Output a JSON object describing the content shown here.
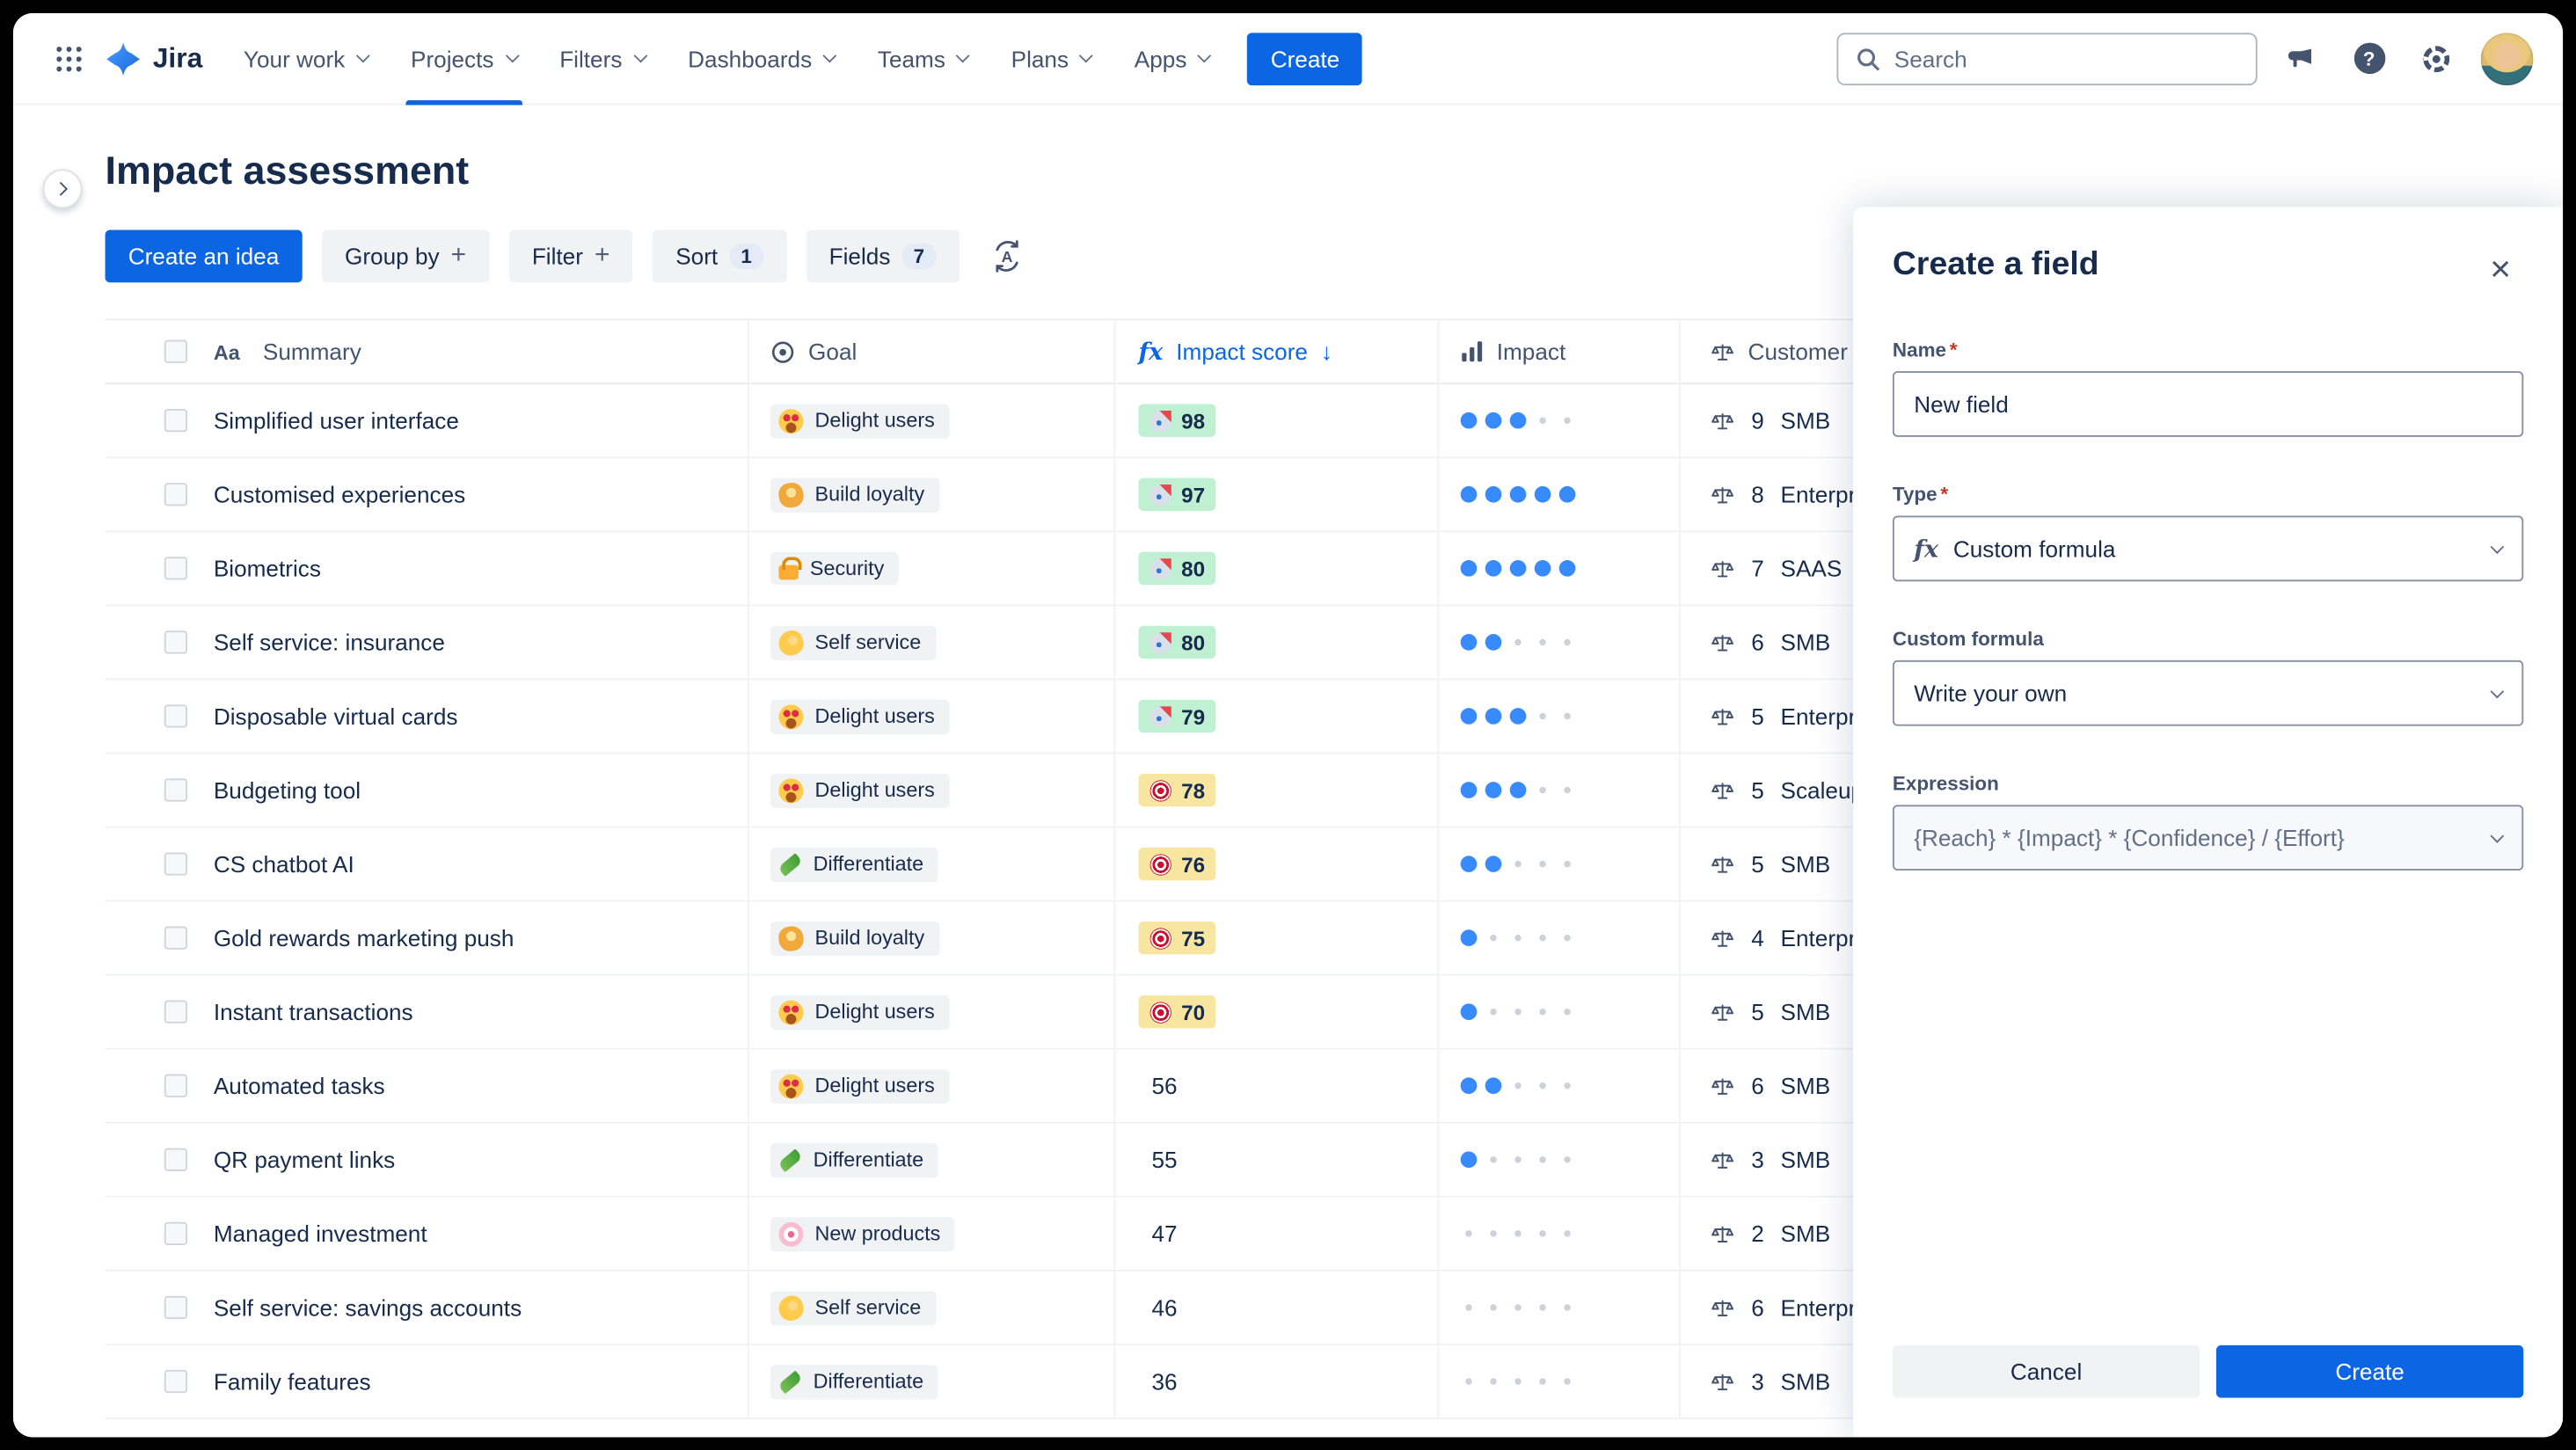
{
  "nav": {
    "brand": "Jira",
    "items": [
      {
        "label": "Your work"
      },
      {
        "label": "Projects"
      },
      {
        "label": "Filters"
      },
      {
        "label": "Dashboards"
      },
      {
        "label": "Teams"
      },
      {
        "label": "Plans"
      },
      {
        "label": "Apps"
      }
    ],
    "active_item": "Projects",
    "create_label": "Create",
    "search_placeholder": "Search"
  },
  "icons": {
    "close": "×",
    "plus": "+",
    "sort_desc": "↓",
    "help": "?"
  },
  "page": {
    "title": "Impact assessment",
    "toolbar": {
      "create_idea": "Create an idea",
      "group_by": "Group by",
      "filter": "Filter",
      "sort": "Sort",
      "sort_count": "1",
      "fields": "Fields",
      "fields_count": "7"
    }
  },
  "table": {
    "columns": [
      {
        "label": "Summary",
        "icon": "aa"
      },
      {
        "label": "Goal",
        "icon": "goal"
      },
      {
        "label": "Impact score",
        "icon": "fx",
        "sorted": "desc"
      },
      {
        "label": "Impact",
        "icon": "bars"
      },
      {
        "label": "Customer importance",
        "icon": "scale"
      }
    ],
    "rows": [
      {
        "summary": "Simplified user interface",
        "goal": {
          "icon": "heart-eyes",
          "label": "Delight users"
        },
        "score": {
          "value": 98,
          "tier": "green",
          "icon": "rocket"
        },
        "impact": 3,
        "customer": {
          "count": 9,
          "label": "SMB"
        }
      },
      {
        "summary": "Customised experiences",
        "goal": {
          "icon": "handshake",
          "label": "Build loyalty"
        },
        "score": {
          "value": 97,
          "tier": "green",
          "icon": "rocket"
        },
        "impact": 5,
        "customer": {
          "count": 8,
          "label": "Enterprise"
        }
      },
      {
        "summary": "Biometrics",
        "goal": {
          "icon": "lock",
          "label": "Security"
        },
        "score": {
          "value": 80,
          "tier": "green",
          "icon": "rocket"
        },
        "impact": 5,
        "customer": {
          "count": 7,
          "label": "SAAS"
        }
      },
      {
        "summary": "Self service: insurance",
        "goal": {
          "icon": "muscle",
          "label": "Self service"
        },
        "score": {
          "value": 80,
          "tier": "green",
          "icon": "rocket"
        },
        "impact": 2,
        "customer": {
          "count": 6,
          "label": "SMB"
        }
      },
      {
        "summary": "Disposable virtual cards",
        "goal": {
          "icon": "heart-eyes",
          "label": "Delight users"
        },
        "score": {
          "value": 79,
          "tier": "green",
          "icon": "rocket"
        },
        "impact": 3,
        "customer": {
          "count": 5,
          "label": "Enterprise"
        }
      },
      {
        "summary": "Budgeting tool",
        "goal": {
          "icon": "heart-eyes",
          "label": "Delight users"
        },
        "score": {
          "value": 78,
          "tier": "yellow",
          "icon": "dart"
        },
        "impact": 3,
        "customer": {
          "count": 5,
          "label": "Scaleups"
        }
      },
      {
        "summary": "CS chatbot AI",
        "goal": {
          "icon": "leaf",
          "label": "Differentiate"
        },
        "score": {
          "value": 76,
          "tier": "yellow",
          "icon": "dart"
        },
        "impact": 2,
        "customer": {
          "count": 5,
          "label": "SMB"
        }
      },
      {
        "summary": "Gold rewards marketing push",
        "goal": {
          "icon": "handshake",
          "label": "Build loyalty"
        },
        "score": {
          "value": 75,
          "tier": "yellow",
          "icon": "dart"
        },
        "impact": 1,
        "customer": {
          "count": 4,
          "label": "Enterprise"
        }
      },
      {
        "summary": "Instant transactions",
        "goal": {
          "icon": "heart-eyes",
          "label": "Delight users"
        },
        "score": {
          "value": 70,
          "tier": "yellow",
          "icon": "dart"
        },
        "impact": 1,
        "customer": {
          "count": 5,
          "label": "SMB"
        }
      },
      {
        "summary": "Automated tasks",
        "goal": {
          "icon": "heart-eyes",
          "label": "Delight users"
        },
        "score": {
          "value": 56,
          "tier": "none",
          "icon": null
        },
        "impact": 2,
        "customer": {
          "count": 6,
          "label": "SMB"
        }
      },
      {
        "summary": "QR payment links",
        "goal": {
          "icon": "leaf",
          "label": "Differentiate"
        },
        "score": {
          "value": 55,
          "tier": "none",
          "icon": null
        },
        "impact": 1,
        "customer": {
          "count": 3,
          "label": "SMB"
        }
      },
      {
        "summary": "Managed investment",
        "goal": {
          "icon": "swirl",
          "label": "New products"
        },
        "score": {
          "value": 47,
          "tier": "none",
          "icon": null
        },
        "impact": 0,
        "customer": {
          "count": 2,
          "label": "SMB"
        }
      },
      {
        "summary": "Self service: savings accounts",
        "goal": {
          "icon": "muscle",
          "label": "Self service"
        },
        "score": {
          "value": 46,
          "tier": "none",
          "icon": null
        },
        "impact": 0,
        "customer": {
          "count": 6,
          "label": "Enterprise"
        }
      },
      {
        "summary": "Family features",
        "goal": {
          "icon": "leaf",
          "label": "Differentiate"
        },
        "score": {
          "value": 36,
          "tier": "none",
          "icon": null
        },
        "impact": 0,
        "customer": {
          "count": 3,
          "label": "SMB"
        }
      }
    ]
  },
  "panel": {
    "title": "Create a field",
    "name_label": "Name",
    "name_value": "New field",
    "type_label": "Type",
    "type_value": "Custom formula",
    "formula_label": "Custom formula",
    "formula_value": "Write your own",
    "expression_label": "Expression",
    "expression_value": "{Reach} * {Impact} * {Confidence} / {Effort}",
    "cancel_label": "Cancel",
    "create_label": "Create"
  },
  "colors": {
    "brand_blue": "#0C66E4",
    "score_green_bg": "#BFF0D1",
    "score_yellow_bg": "#F8E6A0",
    "impact_dot_blue": "#388BFF",
    "text_primary": "#172B4D",
    "text_subtle": "#44546F"
  }
}
